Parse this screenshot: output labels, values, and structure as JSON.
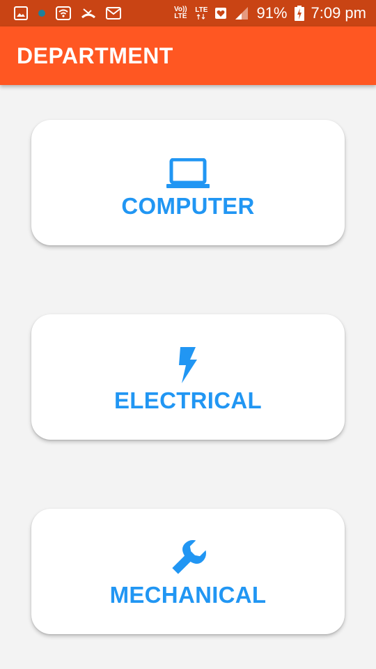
{
  "status_bar": {
    "icons": [
      "image-icon",
      "notification-dot-icon",
      "wifi-icon",
      "missed-call-icon",
      "mail-icon",
      "volte-icon",
      "lte-data-icon",
      "heart-icon",
      "signal-icon",
      "battery-icon"
    ],
    "volte_label": "Vo)) LTE",
    "lte_label": "LTE",
    "battery": "91%",
    "time": "7:09 pm"
  },
  "app_bar": {
    "title": "DEPARTMENT"
  },
  "departments": [
    {
      "label": "COMPUTER",
      "icon": "laptop-icon"
    },
    {
      "label": "ELECTRICAL",
      "icon": "lightning-bolt-icon"
    },
    {
      "label": "MECHANICAL",
      "icon": "wrench-icon"
    }
  ],
  "colors": {
    "status_bar": "#c94414",
    "app_bar": "#ff5722",
    "accent": "#2196f3",
    "background": "#f3f3f3",
    "card": "#ffffff"
  }
}
